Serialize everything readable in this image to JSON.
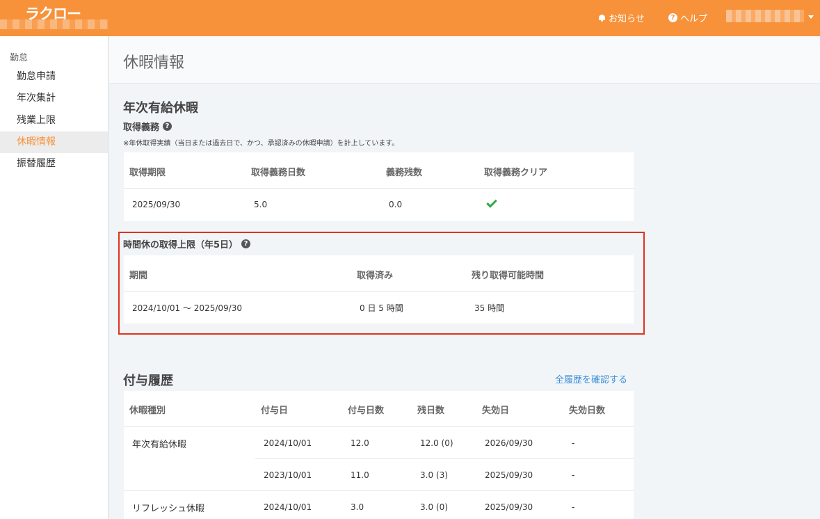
{
  "header": {
    "logo": "ラクロー",
    "notice_label": "お知らせ",
    "help_label": "ヘルプ"
  },
  "sidebar": {
    "section": "勤怠",
    "items": [
      {
        "label": "勤怠申請"
      },
      {
        "label": "年次集計"
      },
      {
        "label": "残業上限"
      },
      {
        "label": "休暇情報"
      },
      {
        "label": "振替履歴"
      }
    ]
  },
  "page": {
    "title": "休暇情報"
  },
  "annual": {
    "title": "年次有給休暇",
    "obligation": {
      "title": "取得義務",
      "note": "※年休取得実績（当日または過去日で、かつ、承認済みの休暇申請）を計上しています。",
      "headers": [
        "取得期限",
        "取得義務日数",
        "義務残数",
        "取得義務クリア"
      ],
      "row": {
        "deadline": "2025/09/30",
        "days": "5.0",
        "remaining": "0.0"
      }
    },
    "hourly": {
      "title": "時間休の取得上限（年5日）",
      "headers": [
        "期間",
        "取得済み",
        "残り取得可能時間"
      ],
      "row": {
        "period": "2024/10/01 〜 2025/09/30",
        "taken": "0 日 5 時間",
        "remaining": "35 時間"
      }
    }
  },
  "grant": {
    "title": "付与履歴",
    "link": "全履歴を確認する",
    "headers": [
      "休暇種別",
      "付与日",
      "付与日数",
      "残日数",
      "失効日",
      "失効日数"
    ],
    "rows": [
      {
        "type": "年次有給休暇",
        "date": "2024/10/01",
        "days": "12.0",
        "remain": "12.0 (0)",
        "expire": "2026/09/30",
        "expire_days": "-"
      },
      {
        "type": "",
        "date": "2023/10/01",
        "days": "11.0",
        "remain": "3.0 (3)",
        "expire": "2025/09/30",
        "expire_days": "-"
      },
      {
        "type": "リフレッシュ休暇",
        "date": "2024/10/01",
        "days": "3.0",
        "remain": "3.0 (0)",
        "expire": "2025/09/30",
        "expire_days": "-"
      }
    ]
  },
  "colors": {
    "brand": "#f7923a",
    "highlight": "#e0321e",
    "link": "#3a8ed8",
    "check": "#2eaa4a"
  }
}
